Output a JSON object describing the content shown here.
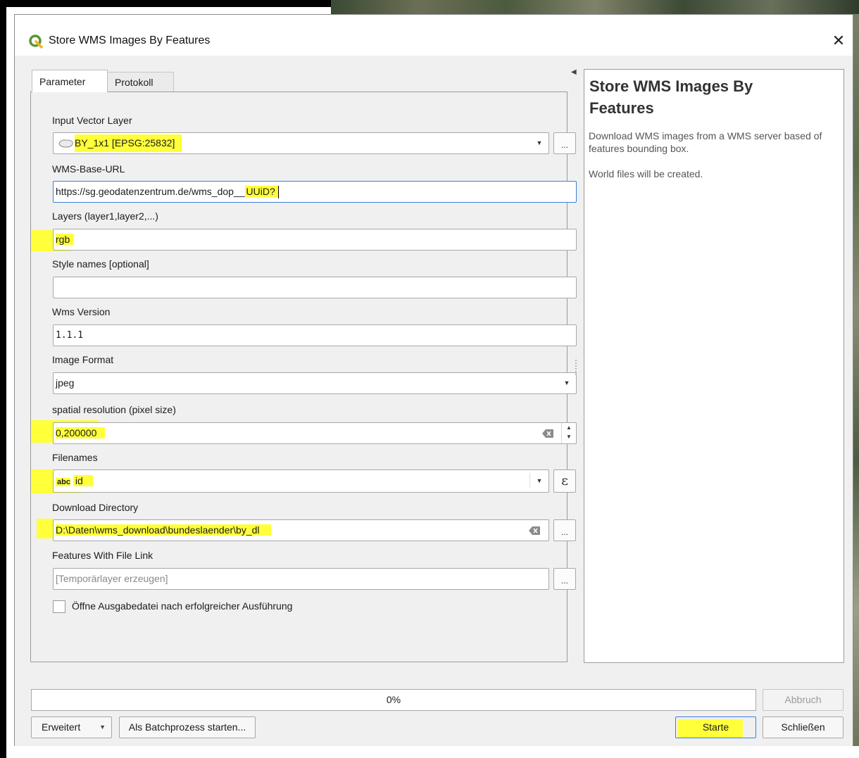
{
  "window": {
    "title": "Store WMS Images By Features",
    "close_symbol": "✕"
  },
  "tabs": [
    {
      "label": "Parameter"
    },
    {
      "label": "Protokoll"
    }
  ],
  "params": {
    "input_vector_layer": {
      "label": "Input Vector Layer",
      "value": "BY_1x1 [EPSG:25832]"
    },
    "wms_base_url": {
      "label": "WMS-Base-URL",
      "value_prefix": "https://sg.geodatenzentrum.de/wms_dop__",
      "value_suffix": "UUiD?"
    },
    "layers": {
      "label": "Layers (layer1,layer2,...)",
      "value": "rgb"
    },
    "style_names": {
      "label": "Style names [optional]",
      "value": ""
    },
    "wms_version": {
      "label": "Wms Version",
      "value": "1.1.1"
    },
    "image_format": {
      "label": "Image Format",
      "value": "jpeg"
    },
    "spatial_resolution": {
      "label": "spatial resolution (pixel size)",
      "value": "0,200000"
    },
    "filenames": {
      "label": "Filenames",
      "type_prefix": "abc",
      "value": "id",
      "expr_symbol": "ε"
    },
    "download_directory": {
      "label": "Download Directory",
      "value": "D:\\Daten\\wms_download\\bundeslaender\\by_dl"
    },
    "features_with_file_link": {
      "label": "Features With File Link",
      "placeholder": "[Temporärlayer erzeugen]"
    },
    "open_output": {
      "label": "Öffne Ausgabedatei nach erfolgreicher Ausführung",
      "checked": false
    }
  },
  "browse_label": "...",
  "help": {
    "title": "Store WMS Images By Features",
    "description": "Download WMS images from a WMS server based of features bounding box.",
    "note": "World files will be created."
  },
  "progress": {
    "text": "0%",
    "value": 0
  },
  "buttons": {
    "abort": "Abbruch",
    "advanced": "Erweitert",
    "batch": "Als Batchprozess starten...",
    "run": "Starte",
    "close": "Schließen"
  },
  "highlight_color": "#ffff3a",
  "accent_color": "#3c7fd6",
  "qgis_green": "#589632"
}
